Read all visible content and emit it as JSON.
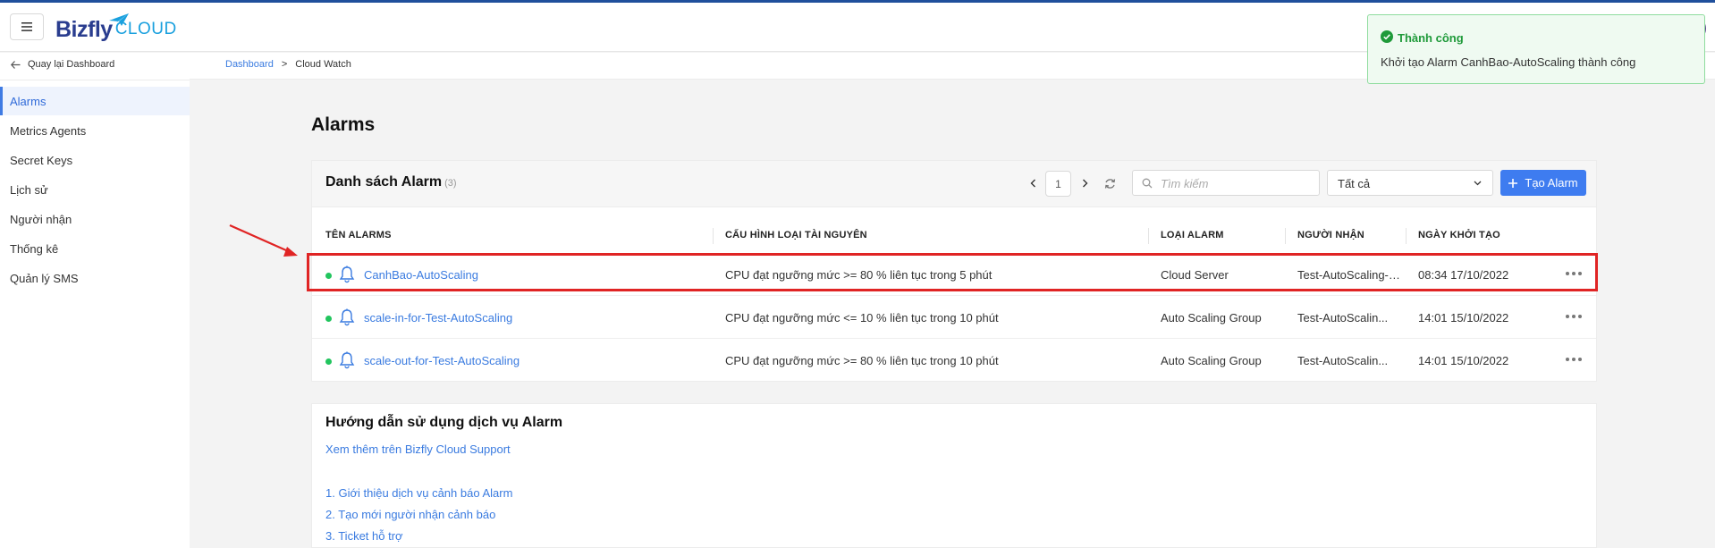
{
  "header": {
    "logo_main": "Bizfly",
    "logo_sub": "CLOUD"
  },
  "sidebar": {
    "back_label": "Quay lại Dashboard",
    "items": [
      {
        "label": "Alarms",
        "active": true
      },
      {
        "label": "Metrics Agents"
      },
      {
        "label": "Secret Keys"
      },
      {
        "label": "Lịch sử"
      },
      {
        "label": "Người nhận"
      },
      {
        "label": "Thống kê"
      },
      {
        "label": "Quản lý SMS"
      }
    ]
  },
  "breadcrumb": {
    "root": "Dashboard",
    "separator": ">",
    "current": "Cloud Watch"
  },
  "page": {
    "title": "Alarms"
  },
  "alarm_list": {
    "title": "Danh sách Alarm",
    "count": "(3)",
    "page_number": "1",
    "search_placeholder": "Tìm kiếm",
    "filter_value": "Tất cả",
    "create_label": "Tạo Alarm",
    "columns": [
      "TÊN ALARMS",
      "CẤU HÌNH LOẠI TÀI NGUYÊN",
      "LOẠI ALARM",
      "NGƯỜI NHẬN",
      "NGÀY KHỞI TẠO"
    ],
    "rows": [
      {
        "name": "CanhBao-AutoScaling",
        "config": "CPU đạt ngưỡng mức >= 80 % liên tục trong 5 phút",
        "type": "Cloud Server",
        "receiver": "Test-AutoScaling-sca",
        "created": "08:34 17/10/2022",
        "status_color": "#22c55e",
        "highlighted": true
      },
      {
        "name": "scale-in-for-Test-AutoScaling",
        "config": "CPU đạt ngưỡng mức <= 10 % liên tục trong 10 phút",
        "type": "Auto Scaling Group",
        "receiver": "Test-AutoScalin...",
        "created": "14:01 15/10/2022",
        "status_color": "#22c55e"
      },
      {
        "name": "scale-out-for-Test-AutoScaling",
        "config": "CPU đạt ngưỡng mức >= 80 % liên tục trong 10 phút",
        "type": "Auto Scaling Group",
        "receiver": "Test-AutoScalin...",
        "created": "14:01 15/10/2022",
        "status_color": "#22c55e"
      }
    ]
  },
  "guide": {
    "title": "Hướng dẫn sử dụng dịch vụ Alarm",
    "support_link": "Xem thêm trên Bizfly Cloud Support",
    "links": [
      "1. Giới thiệu dịch vụ cảnh báo Alarm",
      "2. Tạo mới người nhận cảnh báo",
      "3. Ticket hỗ trợ"
    ]
  },
  "toast": {
    "title": "Thành công",
    "message": "Khởi tạo Alarm CanhBao-AutoScaling thành công",
    "color": "#1f9a3a"
  },
  "colors": {
    "accent": "#3e7cf0",
    "link": "#3a7be0",
    "highlight_border": "#e02424",
    "status_active": "#22c55e"
  },
  "icons": {
    "menu": "hamburger-icon",
    "back": "arrow-left-icon",
    "prev": "chevron-left-icon",
    "next": "chevron-right-icon",
    "refresh": "refresh-icon",
    "search": "search-icon",
    "dropdown": "chevron-down-icon",
    "create": "plus-icon",
    "alarm": "bell-icon",
    "more": "ellipsis-icon",
    "success": "check-circle-icon"
  }
}
